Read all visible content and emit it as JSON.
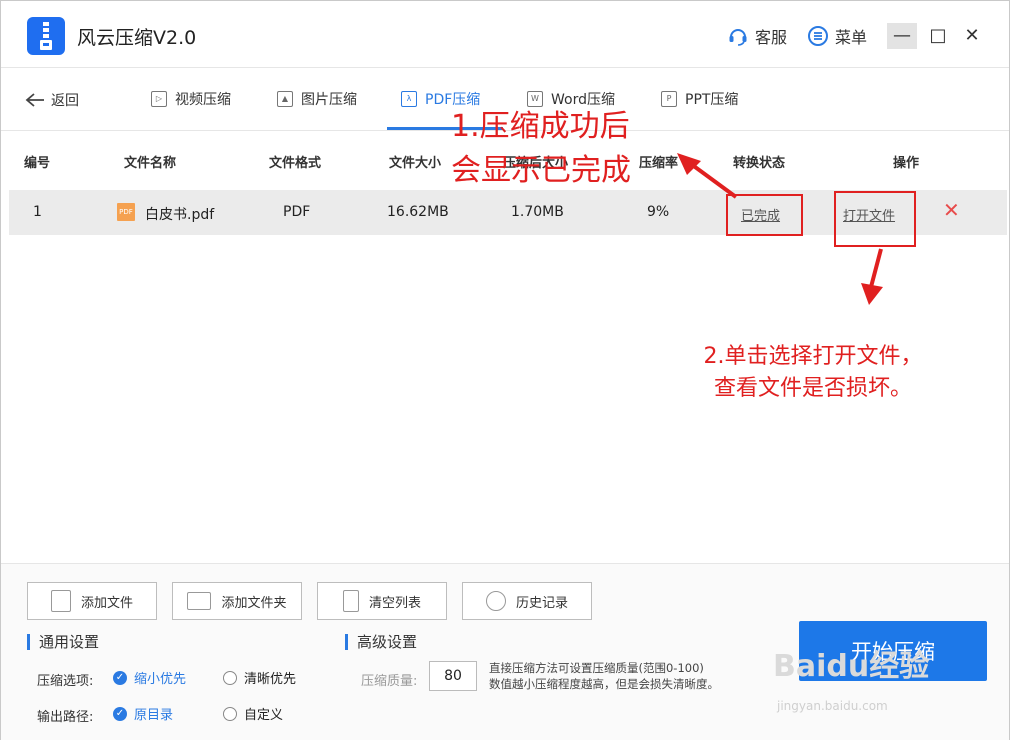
{
  "app": {
    "title": "风云压缩V2.0",
    "service": "客服",
    "menu": "菜单"
  },
  "nav": {
    "back": "返回",
    "tabs": [
      {
        "label": "视频压缩",
        "icon": "video-icon"
      },
      {
        "label": "图片压缩",
        "icon": "image-icon"
      },
      {
        "label": "PDF压缩",
        "icon": "pdf-icon",
        "active": true
      },
      {
        "label": "Word压缩",
        "icon": "word-icon"
      },
      {
        "label": "PPT压缩",
        "icon": "ppt-icon"
      }
    ]
  },
  "table": {
    "headers": [
      "编号",
      "文件名称",
      "文件格式",
      "文件大小",
      "压缩后大小",
      "压缩率",
      "转换状态",
      "操作"
    ],
    "rows": [
      {
        "no": "1",
        "name": "白皮书.pdf",
        "format": "PDF",
        "size": "16.62MB",
        "compressed": "1.70MB",
        "rate": "9%",
        "status": "已完成",
        "action": "打开文件"
      }
    ]
  },
  "annotations": {
    "a1_line1": "1.压缩成功后",
    "a1_line2": "会显示已完成",
    "a2": "2.单击选择打开文件，查看文件是否损坏。"
  },
  "toolbar": {
    "add_file": "添加文件",
    "add_folder": "添加文件夹",
    "clear": "清空列表",
    "history": "历史记录"
  },
  "general": {
    "title": "通用设置",
    "compress_label": "压缩选项:",
    "opt_small": "缩小优先",
    "opt_clear": "清晰优先",
    "output_label": "输出路径:",
    "opt_orig": "原目录",
    "opt_custom": "自定义"
  },
  "advanced": {
    "title": "高级设置",
    "quality_label": "压缩质量:",
    "quality_value": "80",
    "desc1": "直接压缩方法可设置压缩质量(范围0-100)",
    "desc2": "数值越小压缩程度越高，但是会损失清晰度。"
  },
  "start_button": "开始压缩",
  "watermark": {
    "main": "Baidu经验",
    "sub": "jingyan.baidu.com"
  },
  "colors": {
    "accent": "#2a7ae2",
    "annotation": "#e02020",
    "start": "#1d78e8"
  }
}
